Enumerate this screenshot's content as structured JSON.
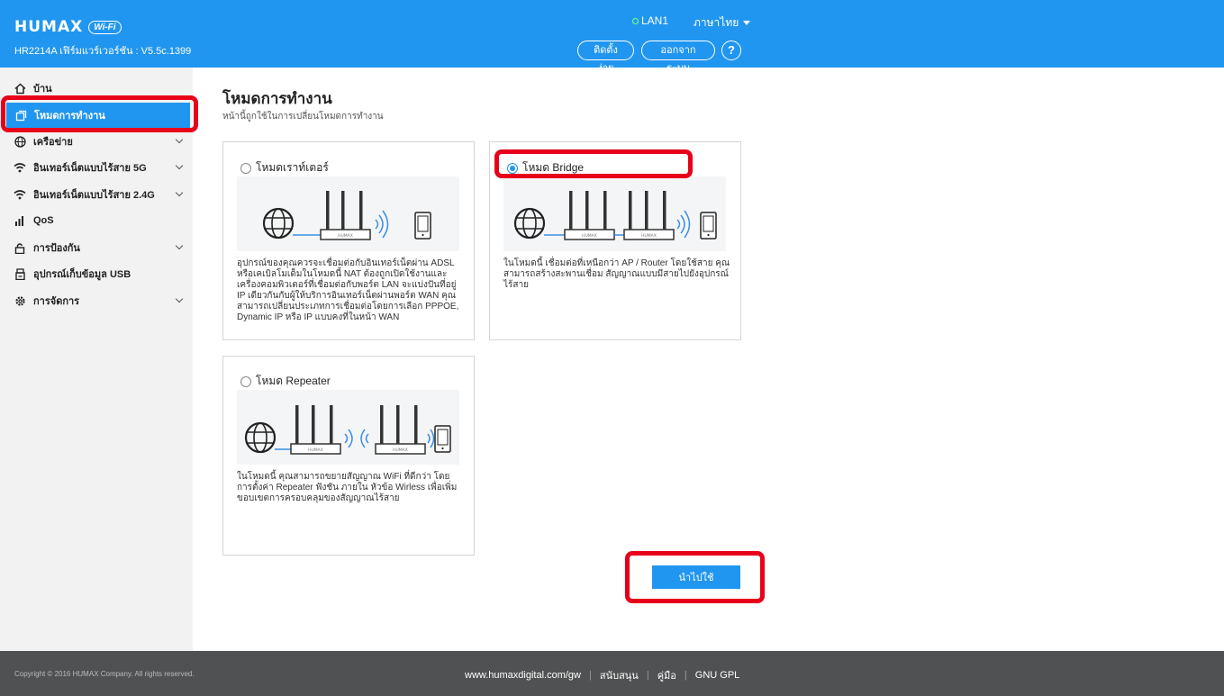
{
  "header": {
    "logo": "HUMAX",
    "logo_badge": "Wi-Fi",
    "firmware": "HR2214A เฟิร์มแวร์เวอร์ชัน : V5.5c.1399",
    "lan": "LAN1",
    "language": "ภาษาไทย",
    "easy_setup": "ติดตั้งง่าย",
    "logout": "ออกจากระบบ",
    "help": "?"
  },
  "sidebar": {
    "items": [
      {
        "label": "บ้าน",
        "icon": "home-icon"
      },
      {
        "label": "โหมดการทำงาน",
        "icon": "copy-icon",
        "active": true
      },
      {
        "label": "เครือข่าย",
        "icon": "globe-icon",
        "expandable": true
      },
      {
        "label": "อินเทอร์เน็ตแบบไร้สาย 5G",
        "icon": "wifi-icon",
        "expandable": true
      },
      {
        "label": "อินเทอร์เน็ตแบบไร้สาย 2.4G",
        "icon": "wifi-icon",
        "expandable": true
      },
      {
        "label": "QoS",
        "icon": "bar-chart-icon"
      },
      {
        "label": "การป้องกัน",
        "icon": "lock-icon",
        "expandable": true
      },
      {
        "label": "อุปกรณ์เก็บข้อมูล USB",
        "icon": "usb-icon"
      },
      {
        "label": "การจัดการ",
        "icon": "gear-icon",
        "expandable": true
      }
    ]
  },
  "main": {
    "title": "โหมดการทำงาน",
    "subtitle": "หน้านี้ถูกใช้ในการเปลี่ยนโหมดการทำงาน",
    "router": {
      "label": "โหมดเราท์เตอร์",
      "selected": false,
      "description": "อุปกรณ์ของคุณควรจะเชื่อมต่อกับอินเทอร์เน็ตผ่าน ADSL หรือเคเบิลโมเด็มในโหมดนี้ NAT ต้องถูกเปิดใช้งานและเครื่องคอมพิวเตอร์ที่เชื่อมต่อกับพอร์ต LAN จะแบ่งปันที่อยู่ IP เดียวกันกับผู้ให้บริการอินเทอร์เน็ตผ่านพอร์ต WAN คุณสามารถเปลี่ยนประเภทการเชื่อมต่อโดยการเลือก PPPOE, Dynamic IP หรือ IP แบบคงที่ในหน้า WAN"
    },
    "bridge": {
      "label": "โหมด Bridge",
      "selected": true,
      "description": "ในโหมดนี้ เชื่อมต่อที่เหนือกว่า AP / Router โดยใช้สาย คุณสามารถสร้างสะพานเชื่อม สัญญาณแบบมีสายไปยังอุปกรณ์ไร้สาย"
    },
    "repeater": {
      "label": "โหมด Repeater",
      "selected": false,
      "description": "ในโหมดนี้ คุณสามารถขยายสัญญาณ WiFi ที่ดีกว่า โดยการตั้งค่า Repeater ฟังชัน ภายใน หัวข้อ Wirless เพื่อเพิ่มขอบเขตการครอบคลุมของสัญญาณไร้สาย"
    },
    "router_brand": "HUMAX",
    "apply": "นำไปใช้"
  },
  "footer": {
    "copyright": "Copyright © 2016 HUMAX Company. All rights reserved.",
    "url": "www.humaxdigital.com/gw",
    "support": "สนับสนุน",
    "manual": "คู่มือ",
    "gpl": "GNU GPL"
  },
  "colors": {
    "accent": "#2196f0",
    "highlight": "#e8001a",
    "footer": "#505152"
  }
}
